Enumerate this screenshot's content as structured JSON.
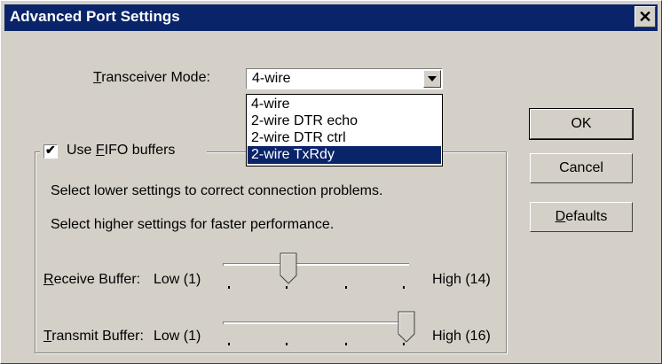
{
  "window": {
    "title": "Advanced Port Settings",
    "close_label": "✕"
  },
  "transceiver": {
    "label_prefix": "",
    "label_ul": "T",
    "label_rest": "ransceiver Mode:",
    "value": "4-wire",
    "options": [
      "4-wire",
      "2-wire DTR echo",
      "2-wire DTR ctrl",
      "2-wire TxRdy"
    ],
    "highlighted_index": 3
  },
  "fifo": {
    "checked": true,
    "label_pre": "Use ",
    "label_ul": "F",
    "label_rest": "IFO buffers",
    "hint1": "Select lower settings to correct connection problems.",
    "hint2": "Select higher settings for faster performance."
  },
  "receive": {
    "label_ul": "R",
    "label_rest": "eceive Buffer:",
    "low": "Low (1)",
    "high": "High (14)",
    "level": 0.333
  },
  "transmit": {
    "label_ul": "T",
    "label_rest": "ransmit Buffer:",
    "low": "Low (1)",
    "high": "High (16)",
    "level": 1.0
  },
  "buttons": {
    "ok": "OK",
    "cancel": "Cancel",
    "defaults_ul": "D",
    "defaults_rest": "efaults"
  }
}
